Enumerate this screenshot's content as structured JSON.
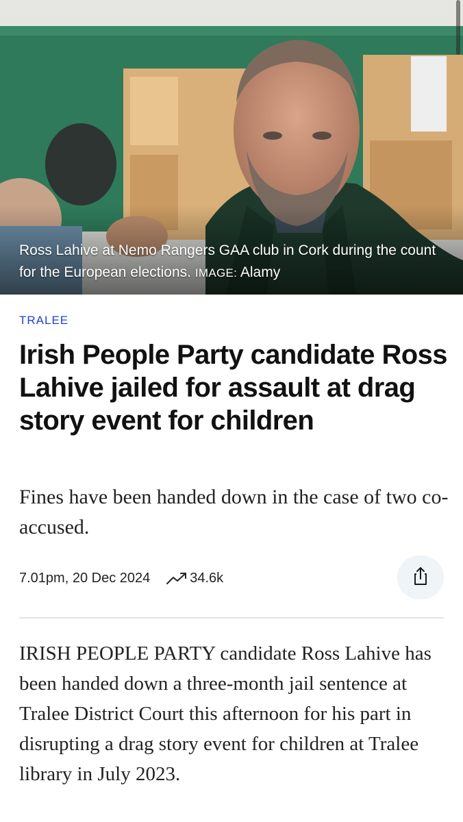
{
  "hero": {
    "caption": "Ross Lahive at Nemo Rangers GAA club in Cork during the count for the European elections.",
    "credit_label": "IMAGE:",
    "credit_name": "Alamy"
  },
  "article": {
    "section": "TRALEE",
    "headline": "Irish People Party candidate Ross Lahive jailed for assault at drag story event for children",
    "standfirst": "Fines have been handed down in the case of two co-accused.",
    "timestamp": "7.01pm, 20 Dec 2024",
    "views": "34.6k",
    "body": "IRISH PEOPLE PARTY candidate Ross Lahive has been handed down a three-month jail sentence at Tralee District Court this afternoon for his part in disrupting a drag story event for children at Tralee library in July 2023."
  },
  "icons": {
    "trend": "trending-up-icon",
    "share": "share-icon"
  },
  "colors": {
    "section_link": "#1f3fd0",
    "share_button_bg": "#eef4f8",
    "text": "#111111"
  }
}
